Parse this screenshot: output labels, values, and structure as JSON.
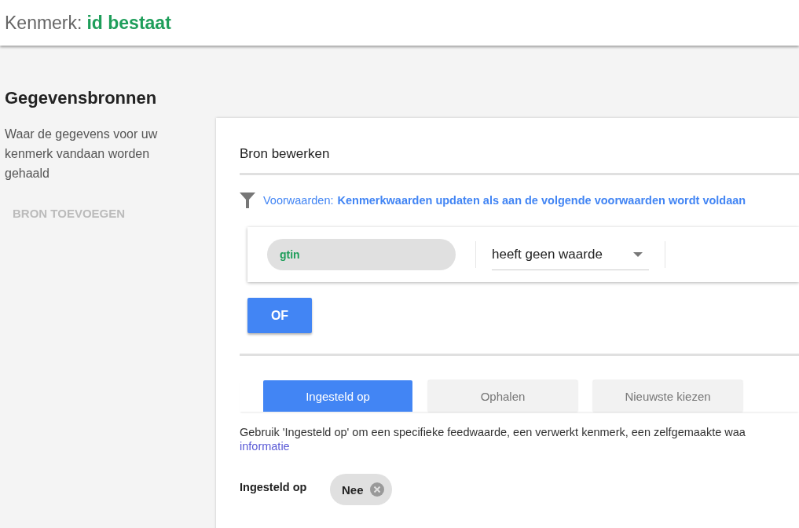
{
  "header": {
    "label": "Kenmerk:",
    "value": "id bestaat"
  },
  "sidebar": {
    "title": "Gegevensbronnen",
    "description": "Waar de gegevens voor uw kenmerk vandaan worden gehaald",
    "add_button": {
      "label": "BRON TOEVOEGEN",
      "disabled": true
    }
  },
  "editor": {
    "title": "Bron bewerken",
    "conditions": {
      "label": "Voorwaarden:",
      "text": "Kenmerkwaarden updaten als aan de volgende voorwaarden wordt voldaan"
    },
    "condition_rows": [
      {
        "attribute": "gtin",
        "operator": "heeft geen waarde"
      }
    ],
    "or_button": "OF",
    "tabs": [
      {
        "label": "Ingesteld op",
        "selected": true
      },
      {
        "label": "Ophalen",
        "selected": false
      },
      {
        "label": "Nieuwste kiezen",
        "selected": false
      }
    ],
    "description": "Gebruik 'Ingesteld op' om een specifieke feedwaarde, een verwerkt kenmerk, een zelfgemaakte waa",
    "link": "informatie",
    "setting": {
      "label": "Ingesteld op",
      "chips": [
        {
          "label": "Nee"
        }
      ]
    }
  }
}
